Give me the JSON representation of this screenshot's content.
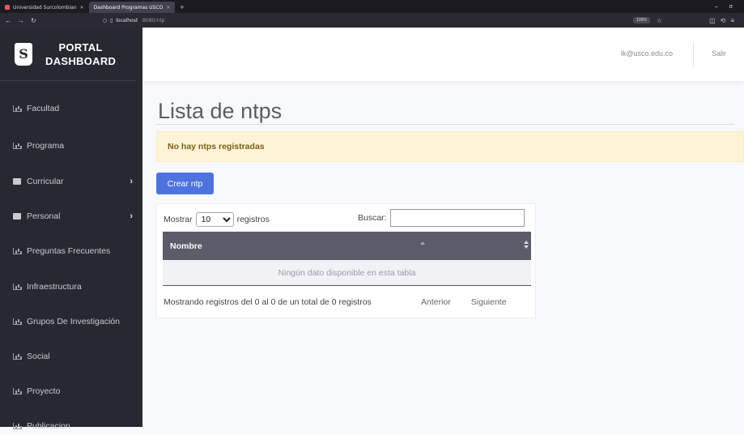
{
  "browser": {
    "tabs": [
      {
        "label": "Universidad Surcolombian",
        "active": false
      },
      {
        "label": "Dashboard Programas USCO",
        "active": true
      }
    ],
    "new_tab": "+",
    "window_controls": "– σ",
    "address_host": "localhost",
    "address_path": ":8080/ntp",
    "zoom": "100%"
  },
  "sidebar": {
    "brand_line1": "PORTAL",
    "brand_line2": "DASHBOARD",
    "items": [
      {
        "label": "Facultad",
        "icon": "chart-icon",
        "submenu": false
      },
      {
        "label": "Programa",
        "icon": "chart-icon",
        "submenu": false
      },
      {
        "label": "Curricular",
        "icon": "folder-icon",
        "submenu": true
      },
      {
        "label": "Personal",
        "icon": "folder-icon",
        "submenu": true
      },
      {
        "label": "Preguntas Frecuentes",
        "icon": "chart-icon",
        "submenu": false
      },
      {
        "label": "Infraestructura",
        "icon": "chart-icon",
        "submenu": false
      },
      {
        "label": "Grupos De Investigación",
        "icon": "chart-icon",
        "submenu": false
      },
      {
        "label": "Social",
        "icon": "chart-icon",
        "submenu": false
      },
      {
        "label": "Proyecto",
        "icon": "chart-icon",
        "submenu": false
      },
      {
        "label": "Publicacion",
        "icon": "chart-icon",
        "submenu": false
      }
    ],
    "arrow_glyph": "›"
  },
  "topbar": {
    "user_email": "lk@usco.edu.co",
    "logout_label": "Salir"
  },
  "main": {
    "title": "Lista de ntps",
    "alert": "No hay ntps registradas",
    "create_button": "Crear ntp",
    "table": {
      "show_label": "Mostrar",
      "page_length": "10",
      "records_label": "registros",
      "search_label": "Buscar:",
      "search_value": "",
      "column_header": "Nombre",
      "empty_message": "Ningún dato disponible en esta tabla",
      "info": "Mostrando registros del 0 al 0 de un total de 0 registros",
      "prev_label": "Anterior",
      "next_label": "Siguiente"
    }
  },
  "colors": {
    "sidebar_bg": "#272930",
    "primary": "#4e73df",
    "alert_bg": "#fdf3d6",
    "table_header_bg": "#5a5c69"
  }
}
